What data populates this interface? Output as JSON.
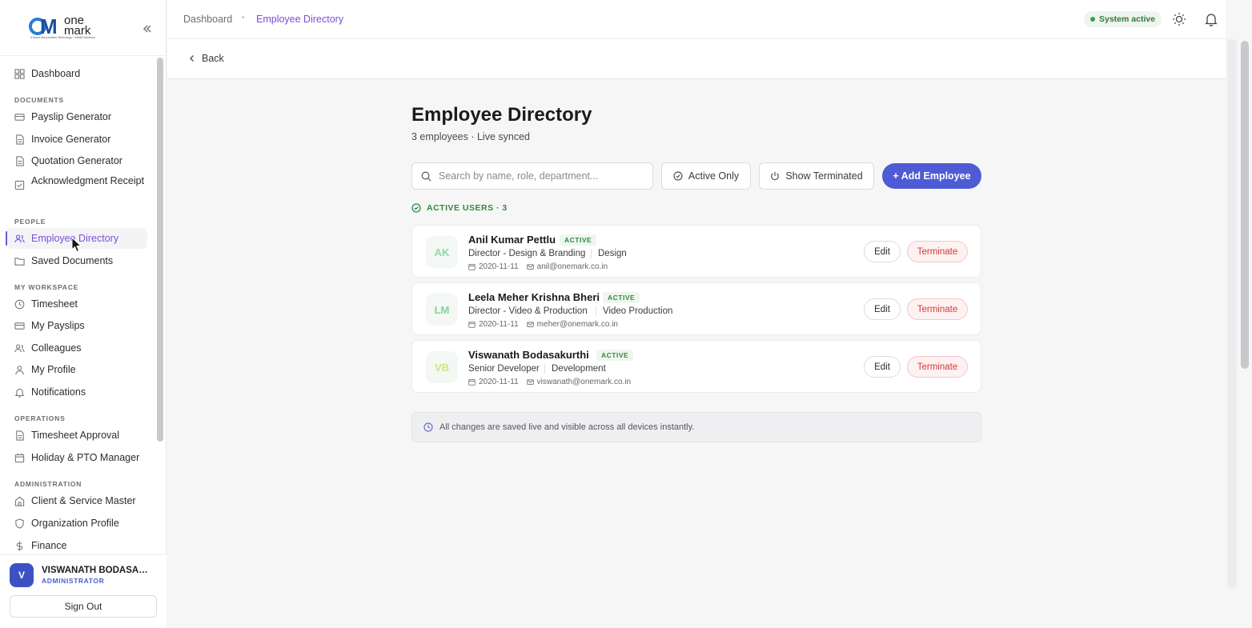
{
  "brand": {
    "logo_mark": "OM",
    "logo_word1": "one",
    "logo_word2": "mark",
    "logo_tagline": "A brand that provides Technology + Media Solutions"
  },
  "sidebar": {
    "dashboard": "Dashboard",
    "sections": {
      "documents": "DOCUMENTS",
      "people": "PEOPLE",
      "workspace": "MY WORKSPACE",
      "operations": "OPERATIONS",
      "administration": "ADMINISTRATION"
    },
    "documents": [
      "Payslip Generator",
      "Invoice Generator",
      "Quotation Generator",
      "Acknowledgment Receipt"
    ],
    "people": [
      "Employee Directory",
      "Saved Documents"
    ],
    "workspace": [
      "Timesheet",
      "My Payslips",
      "Colleagues",
      "My Profile",
      "Notifications"
    ],
    "operations": [
      "Timesheet Approval",
      "Holiday & PTO Manager"
    ],
    "administration": [
      "Client & Service Master",
      "Organization Profile",
      "Finance"
    ],
    "active_item": "Employee Directory"
  },
  "user": {
    "initial": "V",
    "name": "VISWANATH BODASAKURTHI",
    "role": "ADMINISTRATOR",
    "sign_out": "Sign Out"
  },
  "header": {
    "breadcrumb": [
      "Dashboard",
      "Employee Directory"
    ],
    "status": "System active",
    "status_color": "#2fa44a"
  },
  "back_label": "Back",
  "main": {
    "title": "Employee Directory",
    "subtitle": "3 employees · Live synced",
    "search_placeholder": "Search by name, role, department...",
    "filters": {
      "active_only": "Active Only",
      "show_terminated": "Show Terminated"
    },
    "add_button": "+ Add Employee",
    "active_users_label": "ACTIVE USERS · 3",
    "employees": [
      {
        "initials": "AK",
        "name": "Anil Kumar Pettlu",
        "status": "ACTIVE",
        "role": "Director - Design & Branding",
        "department": "Design",
        "joined": "2020-11-11",
        "email": "anil@onemark.co.in",
        "avatar_color": "#8fd8a8"
      },
      {
        "initials": "LM",
        "name": "Leela Meher Krishna Bheri",
        "status": "ACTIVE",
        "role": "Director - Video & Production",
        "department": "Video Production",
        "joined": "2020-11-11",
        "email": "meher@onemark.co.in",
        "avatar_color": "#7fd69a"
      },
      {
        "initials": "VB",
        "name": "Viswanath Bodasakurthi",
        "status": "ACTIVE",
        "role": "Senior Developer",
        "department": "Development",
        "joined": "2020-11-11",
        "email": "viswanath@onemark.co.in",
        "avatar_color": "#d6e27a"
      }
    ],
    "edit_label": "Edit",
    "terminate_label": "Terminate",
    "notice": "All changes are saved live and visible across all devices instantly."
  },
  "colors": {
    "accent": "#7c4ed6",
    "primary_button": "#4f5bd5",
    "active_green": "#2f8a40",
    "danger": "#d23a3a"
  }
}
